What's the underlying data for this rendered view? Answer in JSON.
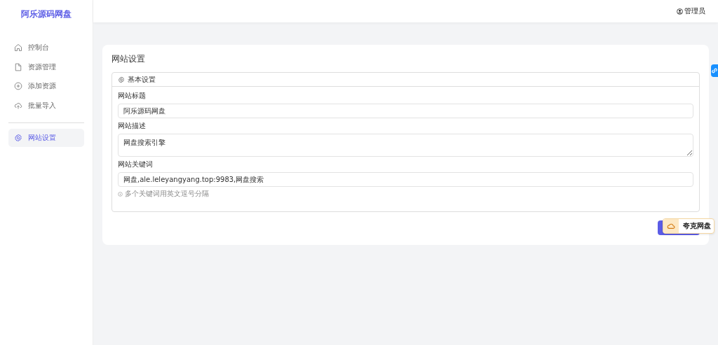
{
  "sidebar": {
    "logo": "阿乐源码网盘",
    "items": [
      {
        "label": "控制台",
        "selected": false
      },
      {
        "label": "资源管理",
        "selected": false
      },
      {
        "label": "添加资源",
        "selected": false
      },
      {
        "label": "批量导入",
        "selected": false
      },
      {
        "label": "网站设置",
        "selected": true
      }
    ]
  },
  "header": {
    "user": "管理员"
  },
  "page": {
    "title": "网站设置",
    "section": "基本设置",
    "fields": [
      {
        "kind": "input",
        "label": "网站标题",
        "value": "阿乐源码网盘"
      },
      {
        "kind": "textarea",
        "label": "网站描述",
        "value": "网盘搜索引擎"
      },
      {
        "kind": "input",
        "label": "网站关键词",
        "value": "网盘,ale.leleyangyang.top:9983,网盘搜索",
        "hint": "多个关键词用英文逗号分隔"
      }
    ]
  },
  "floating_widget": {
    "label": "夸克网盘"
  }
}
